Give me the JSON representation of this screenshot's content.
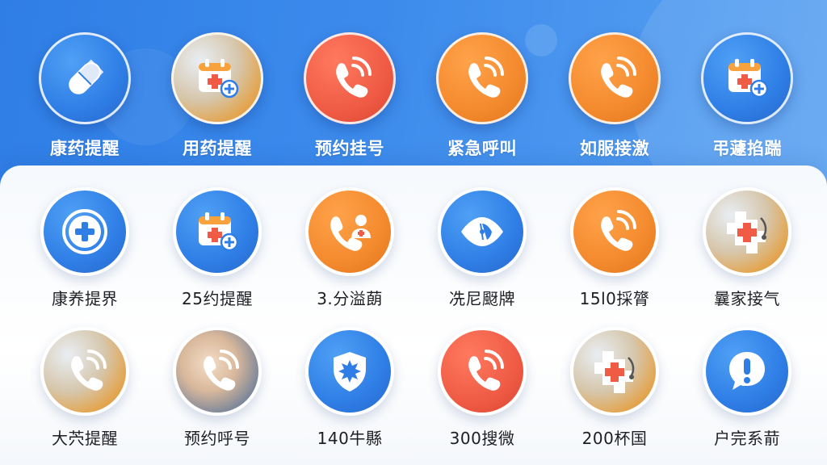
{
  "colors": {
    "blue": "#3587ea",
    "red": "#ef5b45",
    "orange": "#f48a2e",
    "white": "#ffffff"
  },
  "rows": [
    {
      "tiles": [
        {
          "label": "康药提醒",
          "icon": "pill-icon",
          "color": "blue"
        },
        {
          "label": "用药提醒",
          "icon": "calendar-plus-icon",
          "color": "photo"
        },
        {
          "label": "预约挂号",
          "icon": "phone-icon",
          "color": "red"
        },
        {
          "label": "紧急呼叫",
          "icon": "phone-icon",
          "color": "orange"
        },
        {
          "label": "如服接激",
          "icon": "phone-icon",
          "color": "orange"
        },
        {
          "label": "弔蘧掐踹",
          "icon": "calendar-plus-icon",
          "color": "blue"
        }
      ]
    },
    {
      "tiles": [
        {
          "label": "康养提界",
          "icon": "medical-cross-icon",
          "color": "blue"
        },
        {
          "label": "25约提醒",
          "icon": "calendar-plus-icon",
          "color": "blue"
        },
        {
          "label": "3.分溢蓢",
          "icon": "phone-doctor-icon",
          "color": "orange"
        },
        {
          "label": "冼尼颬牌",
          "icon": "eye-icon",
          "color": "blue"
        },
        {
          "label": "15l0採膂",
          "icon": "phone-icon",
          "color": "orange"
        },
        {
          "label": "曩家接气",
          "icon": "medical-kit-icon",
          "color": "photo"
        }
      ]
    },
    {
      "tiles": [
        {
          "label": "大茓提醒",
          "icon": "phone-icon",
          "color": "photo"
        },
        {
          "label": "预约呼号",
          "icon": "phone-icon",
          "color": "photo-person"
        },
        {
          "label": "140牛縣",
          "icon": "shield-cross-icon",
          "color": "blue"
        },
        {
          "label": "300搜微",
          "icon": "phone-icon",
          "color": "red"
        },
        {
          "label": "200杯国",
          "icon": "medical-kit-icon",
          "color": "photo"
        },
        {
          "label": "户完系葥",
          "icon": "alert-bubble-icon",
          "color": "blue"
        }
      ]
    }
  ]
}
